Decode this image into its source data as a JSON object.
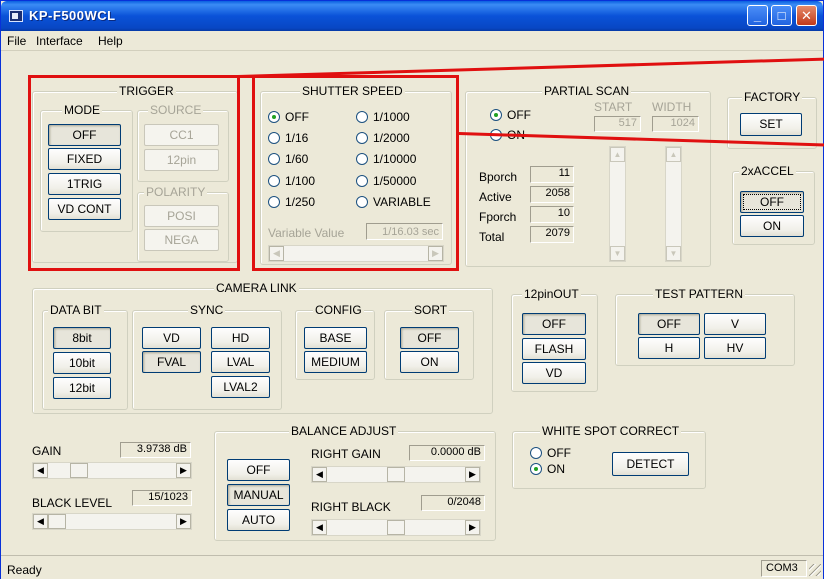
{
  "window": {
    "title": "KP-F500WCL",
    "min_glyph": "_",
    "max_glyph": "□",
    "close_glyph": "✕"
  },
  "menu": [
    {
      "label": "File"
    },
    {
      "label": "Interface"
    },
    {
      "label": "Help"
    }
  ],
  "trigger": {
    "title": "TRIGGER",
    "mode": {
      "title": "MODE",
      "buttons": [
        "OFF",
        "FIXED",
        "1TRIG",
        "VD CONT"
      ],
      "selected": "OFF"
    },
    "source": {
      "title": "SOURCE",
      "buttons": [
        "CC1",
        "12pin"
      ]
    },
    "polarity": {
      "title": "POLARITY",
      "buttons": [
        "POSI",
        "NEGA"
      ]
    }
  },
  "shutter": {
    "title": "SHUTTER SPEED",
    "options": [
      "OFF",
      "1/16",
      "1/60",
      "1/100",
      "1/250",
      "1/1000",
      "1/2000",
      "1/10000",
      "1/50000",
      "VARIABLE"
    ],
    "selected": "OFF",
    "variable_label": "Variable Value",
    "variable_value": "1/16.03 sec"
  },
  "partial_scan": {
    "title": "PARTIAL SCAN",
    "options": [
      "OFF",
      "ON"
    ],
    "selected": "OFF",
    "start_label": "START",
    "start_value": "517",
    "width_label": "WIDTH",
    "width_value": "1024",
    "rows": [
      {
        "label": "Bporch",
        "value": "11"
      },
      {
        "label": "Active",
        "value": "2058"
      },
      {
        "label": "Fporch",
        "value": "10"
      },
      {
        "label": "Total",
        "value": "2079"
      }
    ]
  },
  "factory": {
    "title": "FACTORY",
    "button": "SET"
  },
  "accel": {
    "title": "2xACCEL",
    "buttons": [
      "OFF",
      "ON"
    ],
    "selected": "OFF"
  },
  "camera_link": {
    "title": "CAMERA LINK",
    "data_bit": {
      "title": "DATA BIT",
      "buttons": [
        "8bit",
        "10bit",
        "12bit"
      ],
      "selected": "8bit"
    },
    "sync": {
      "title": "SYNC",
      "buttons": [
        "VD",
        "HD",
        "FVAL",
        "LVAL",
        "LVAL2"
      ],
      "selected": "FVAL"
    },
    "config": {
      "title": "CONFIG",
      "buttons": [
        "BASE",
        "MEDIUM"
      ]
    },
    "sort": {
      "title": "SORT",
      "buttons": [
        "OFF",
        "ON"
      ],
      "selected": "OFF"
    }
  },
  "pin_out": {
    "title": "12pinOUT",
    "buttons": [
      "OFF",
      "FLASH",
      "VD"
    ],
    "selected": "OFF"
  },
  "test_pattern": {
    "title": "TEST PATTERN",
    "buttons": [
      "OFF",
      "V",
      "H",
      "HV"
    ],
    "selected": "OFF"
  },
  "gain": {
    "label": "GAIN",
    "value": "3.9738 dB",
    "level": 0.2
  },
  "black_level": {
    "label": "BLACK LEVEL",
    "value": "15/1023",
    "level": 0.0
  },
  "balance": {
    "title": "BALANCE ADJUST",
    "buttons": [
      "OFF",
      "MANUAL",
      "AUTO"
    ],
    "selected": "MANUAL",
    "right_gain_label": "RIGHT GAIN",
    "right_gain_value": "0.0000 dB",
    "right_gain_level": 0.5,
    "right_black_label": "RIGHT BLACK",
    "right_black_value": "0/2048",
    "right_black_level": 0.5
  },
  "white_spot": {
    "title": "WHITE SPOT CORRECT",
    "options": [
      "OFF",
      "ON"
    ],
    "selected": "ON",
    "button": "DETECT"
  },
  "status": {
    "text": "Ready",
    "port": "COM3"
  },
  "annotation_color": "#e01010"
}
